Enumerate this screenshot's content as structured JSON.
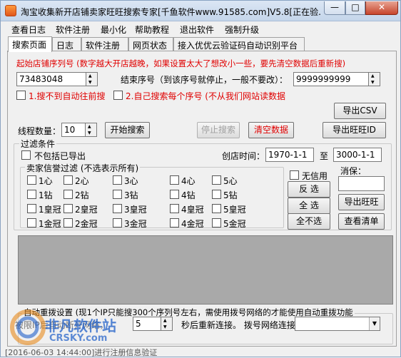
{
  "window": {
    "title": "淘宝收集新开店铺卖家旺旺搜索专家[千鱼软件www.91585.com]V5.8[正在验...",
    "min_glyph": "—",
    "max_glyph": "□",
    "close_glyph": "✕"
  },
  "menu": [
    "查看日志",
    "软件注册",
    "最小化",
    "帮助教程",
    "退出软件",
    "强制升级"
  ],
  "tabs": [
    "搜索页面",
    "日志",
    "软件注册",
    "网页状态",
    "接入优优云验证码自动识别平台"
  ],
  "search": {
    "start_hint": "起始店铺序列号 (数字越大开店越晚，如果设置太大了想改小一些，要先清空数据后重新搜)",
    "start_value": "73483048",
    "end_label": "结束序号（到该序号就停止，一般不要改）：",
    "end_value": "9999999999",
    "option1": "1.搜不到自动往前搜",
    "option2": "2.自己搜索每个序号 (不从我们网站读数据",
    "export_csv": "导出CSV",
    "threads_label": "线程数量：",
    "threads_value": "10",
    "start_btn": "开始搜索",
    "stop_btn": "停止搜索",
    "clear_btn": "清空数据",
    "export_wangwang_id": "导出旺旺ID"
  },
  "filter": {
    "group_title": "过滤条件",
    "exclude_exported": "不包括已导出",
    "created_label": "创店时间：",
    "created_from": "1970-1-1",
    "to_label": "至",
    "created_to": "3000-1-1",
    "credit_title": "卖家信誉过滤 (不选表示所有)",
    "credit_rows": [
      [
        "1心",
        "2心",
        "3心",
        "4心",
        "5心"
      ],
      [
        "1钻",
        "2钻",
        "3钻",
        "4钻",
        "5钻"
      ],
      [
        "1皇冠",
        "2皇冠",
        "3皇冠",
        "4皇冠",
        "5皇冠"
      ],
      [
        "1金冠",
        "2金冠",
        "3金冠",
        "4金冠",
        "5金冠"
      ]
    ],
    "no_use": "无信用",
    "invert": "反 选",
    "select_all": "全 选",
    "select_none": "全不选",
    "consume_label": "消保：",
    "export_wangwang": "导出旺旺",
    "view_list": "查看清单"
  },
  "redial": {
    "title": "自动重拨设置 (现1个IP只能搜300个序列号左右，需使用拨号网络的才能使用自动重拨功能",
    "limit_label": "被限IP后自动断开网络，",
    "seconds_value": "5",
    "reconnect_label": "秒后重新连接。 拨号网络连接：",
    "dial_value": ""
  },
  "status": {
    "text": "[2016-06-03 14:44:00]进行注册信息验证"
  },
  "watermark": {
    "brand": "非凡软件站",
    "site": "CRSKY.com"
  }
}
